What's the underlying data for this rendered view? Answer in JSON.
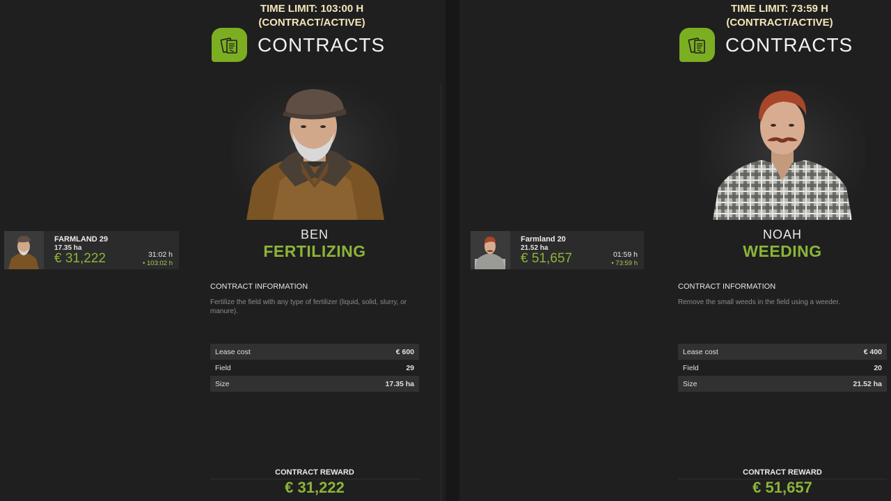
{
  "left": {
    "time_limit_line1": "TIME LIMIT: 103:00 H",
    "time_limit_line2": "(CONTRACT/ACTIVE)",
    "header_title": "CONTRACTS",
    "npc_name": "BEN",
    "job_title": "FERTILIZING",
    "info_title": "CONTRACT INFORMATION",
    "description": "Fertilize the field with any type of fertilizer (liquid, solid, slurry, or manure).",
    "details": [
      {
        "label": "Lease cost",
        "value": "€ 600"
      },
      {
        "label": "Field",
        "value": "29"
      },
      {
        "label": "Size",
        "value": "17.35 ha"
      }
    ],
    "reward_title": "CONTRACT REWARD",
    "reward_value": "€ 31,222",
    "card": {
      "name": "FARMLAND 29",
      "size": "17.35 ha",
      "money": "€ 31,222",
      "time": "31:02 h",
      "total": "• 103:02 h"
    }
  },
  "right": {
    "time_limit_line1": "TIME LIMIT: 73:59 H",
    "time_limit_line2": "(CONTRACT/ACTIVE)",
    "header_title": "CONTRACTS",
    "npc_name": "NOAH",
    "job_title": "WEEDING",
    "info_title": "CONTRACT INFORMATION",
    "description": "Remove the small weeds in the field using a weeder.",
    "details": [
      {
        "label": "Lease cost",
        "value": "€ 400"
      },
      {
        "label": "Field",
        "value": "20"
      },
      {
        "label": "Size",
        "value": "21.52 ha"
      }
    ],
    "reward_title": "CONTRACT REWARD",
    "reward_value": "€ 51,657",
    "card": {
      "name": "Farmland 20",
      "size": "21.52 ha",
      "money": "€ 51,657",
      "time": "01:59 h",
      "total": "• 73:59 h"
    }
  },
  "colors": {
    "accent_green": "#8cb43a",
    "icon_green": "#7cae22",
    "time_limit_text": "#f2e6b8",
    "background": "#1f1f1f"
  },
  "icons": {
    "header_icon": "contract-document-icon",
    "portrait_left": "farmer-ben-portrait",
    "portrait_right": "farmer-noah-portrait"
  }
}
